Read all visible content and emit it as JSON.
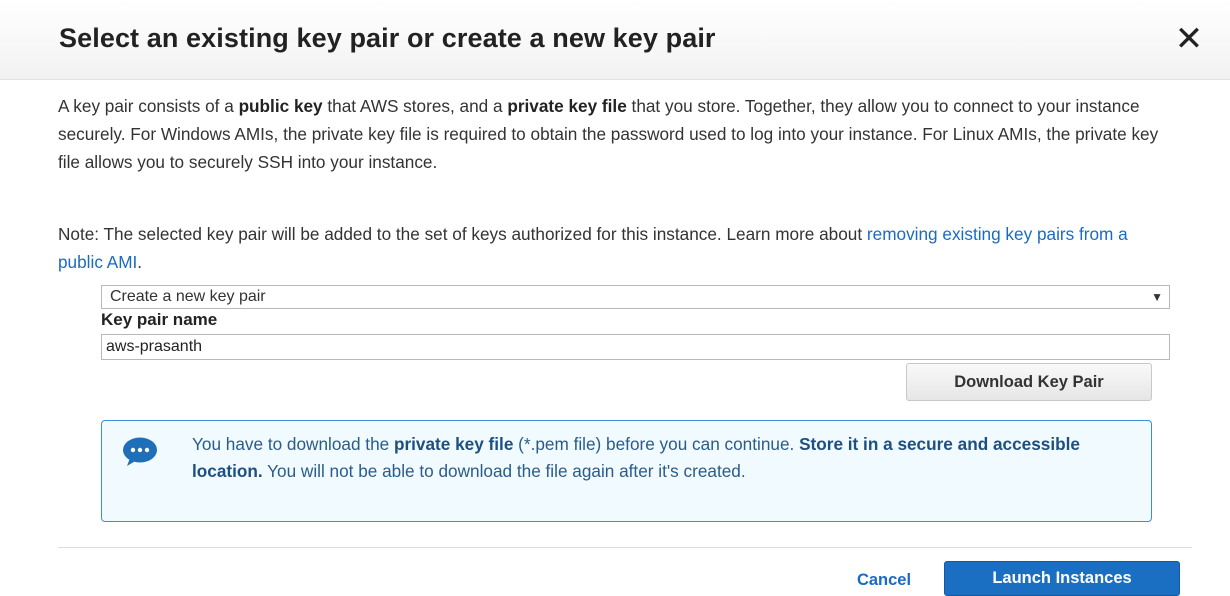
{
  "dialog": {
    "title": "Select an existing key pair or create a new key pair",
    "close_symbol": "✕"
  },
  "description": {
    "p1_a": "A key pair consists of a ",
    "p1_b": "public key",
    "p1_c": " that AWS stores, and a ",
    "p1_d": "private key file",
    "p1_e": " that you store. Together, they allow you to connect to your instance securely. For Windows AMIs, the private key file is required to obtain the password used to log into your instance. For Linux AMIs, the private key file allows you to securely SSH into your instance.",
    "p2_a": "Note: The selected key pair will be added to the set of keys authorized for this instance. Learn more about ",
    "p2_link": "removing existing key pairs from a public AMI",
    "p2_end": "."
  },
  "key_pair_select": {
    "value": "Create a new key pair",
    "arrow": "▼"
  },
  "key_pair_name": {
    "label": "Key pair name",
    "value": "aws-prasanth"
  },
  "download_button": "Download Key Pair",
  "info": {
    "icon": "chat-bubble-ellipsis-icon",
    "t1": "You have to download the ",
    "t2": "private key file",
    "t3": " (*.pem file) before you can continue. ",
    "t4": "Store it in a secure and accessible location.",
    "t5": " You will not be able to download the file again after it's created."
  },
  "footer": {
    "cancel_label": "Cancel",
    "launch_label": "Launch Instances"
  },
  "colors": {
    "primary_button": "#1b6fc3",
    "link": "#1a6bc4",
    "info_border": "#3c8fd6",
    "info_background": "#f1faff"
  }
}
